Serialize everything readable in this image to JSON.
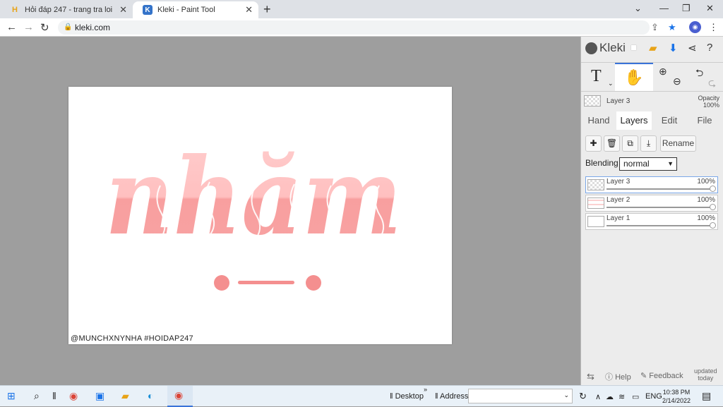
{
  "browser": {
    "tabs": [
      {
        "title": "Hỏi đáp 247 - trang tra loi",
        "icon": "hoidap-favicon"
      },
      {
        "title": "Kleki - Paint Tool",
        "icon": "kleki-favicon"
      }
    ],
    "url": "kleki.com"
  },
  "canvas": {
    "artwork_text": "nhăm",
    "watermark": "@MUNCHXNYNHA #HOIDAP247",
    "colors": {
      "fill": "#f7a3a3",
      "light": "#ffd1d1",
      "dot": "#f48f8f"
    }
  },
  "panel": {
    "brand": "Kleki",
    "current_layer": "Layer 3",
    "opacity_label": "Opacity",
    "opacity_value": "100%",
    "tabs": [
      "Hand",
      "Layers",
      "Edit",
      "File"
    ],
    "active_tab": "Layers",
    "rename_label": "Rename",
    "blending_label": "Blending",
    "blending_value": "normal",
    "layers": [
      {
        "name": "Layer 3",
        "opacity": "100%"
      },
      {
        "name": "Layer 2",
        "opacity": "100%"
      },
      {
        "name": "Layer 1",
        "opacity": "100%"
      }
    ],
    "footer": {
      "help": "Help",
      "feedback": "Feedback",
      "updated": "updated",
      "today": "today"
    }
  },
  "taskbar": {
    "desktop": "Desktop",
    "address": "Address",
    "lang": "ENG",
    "time": "10:38 PM",
    "date": "2/14/2022"
  }
}
